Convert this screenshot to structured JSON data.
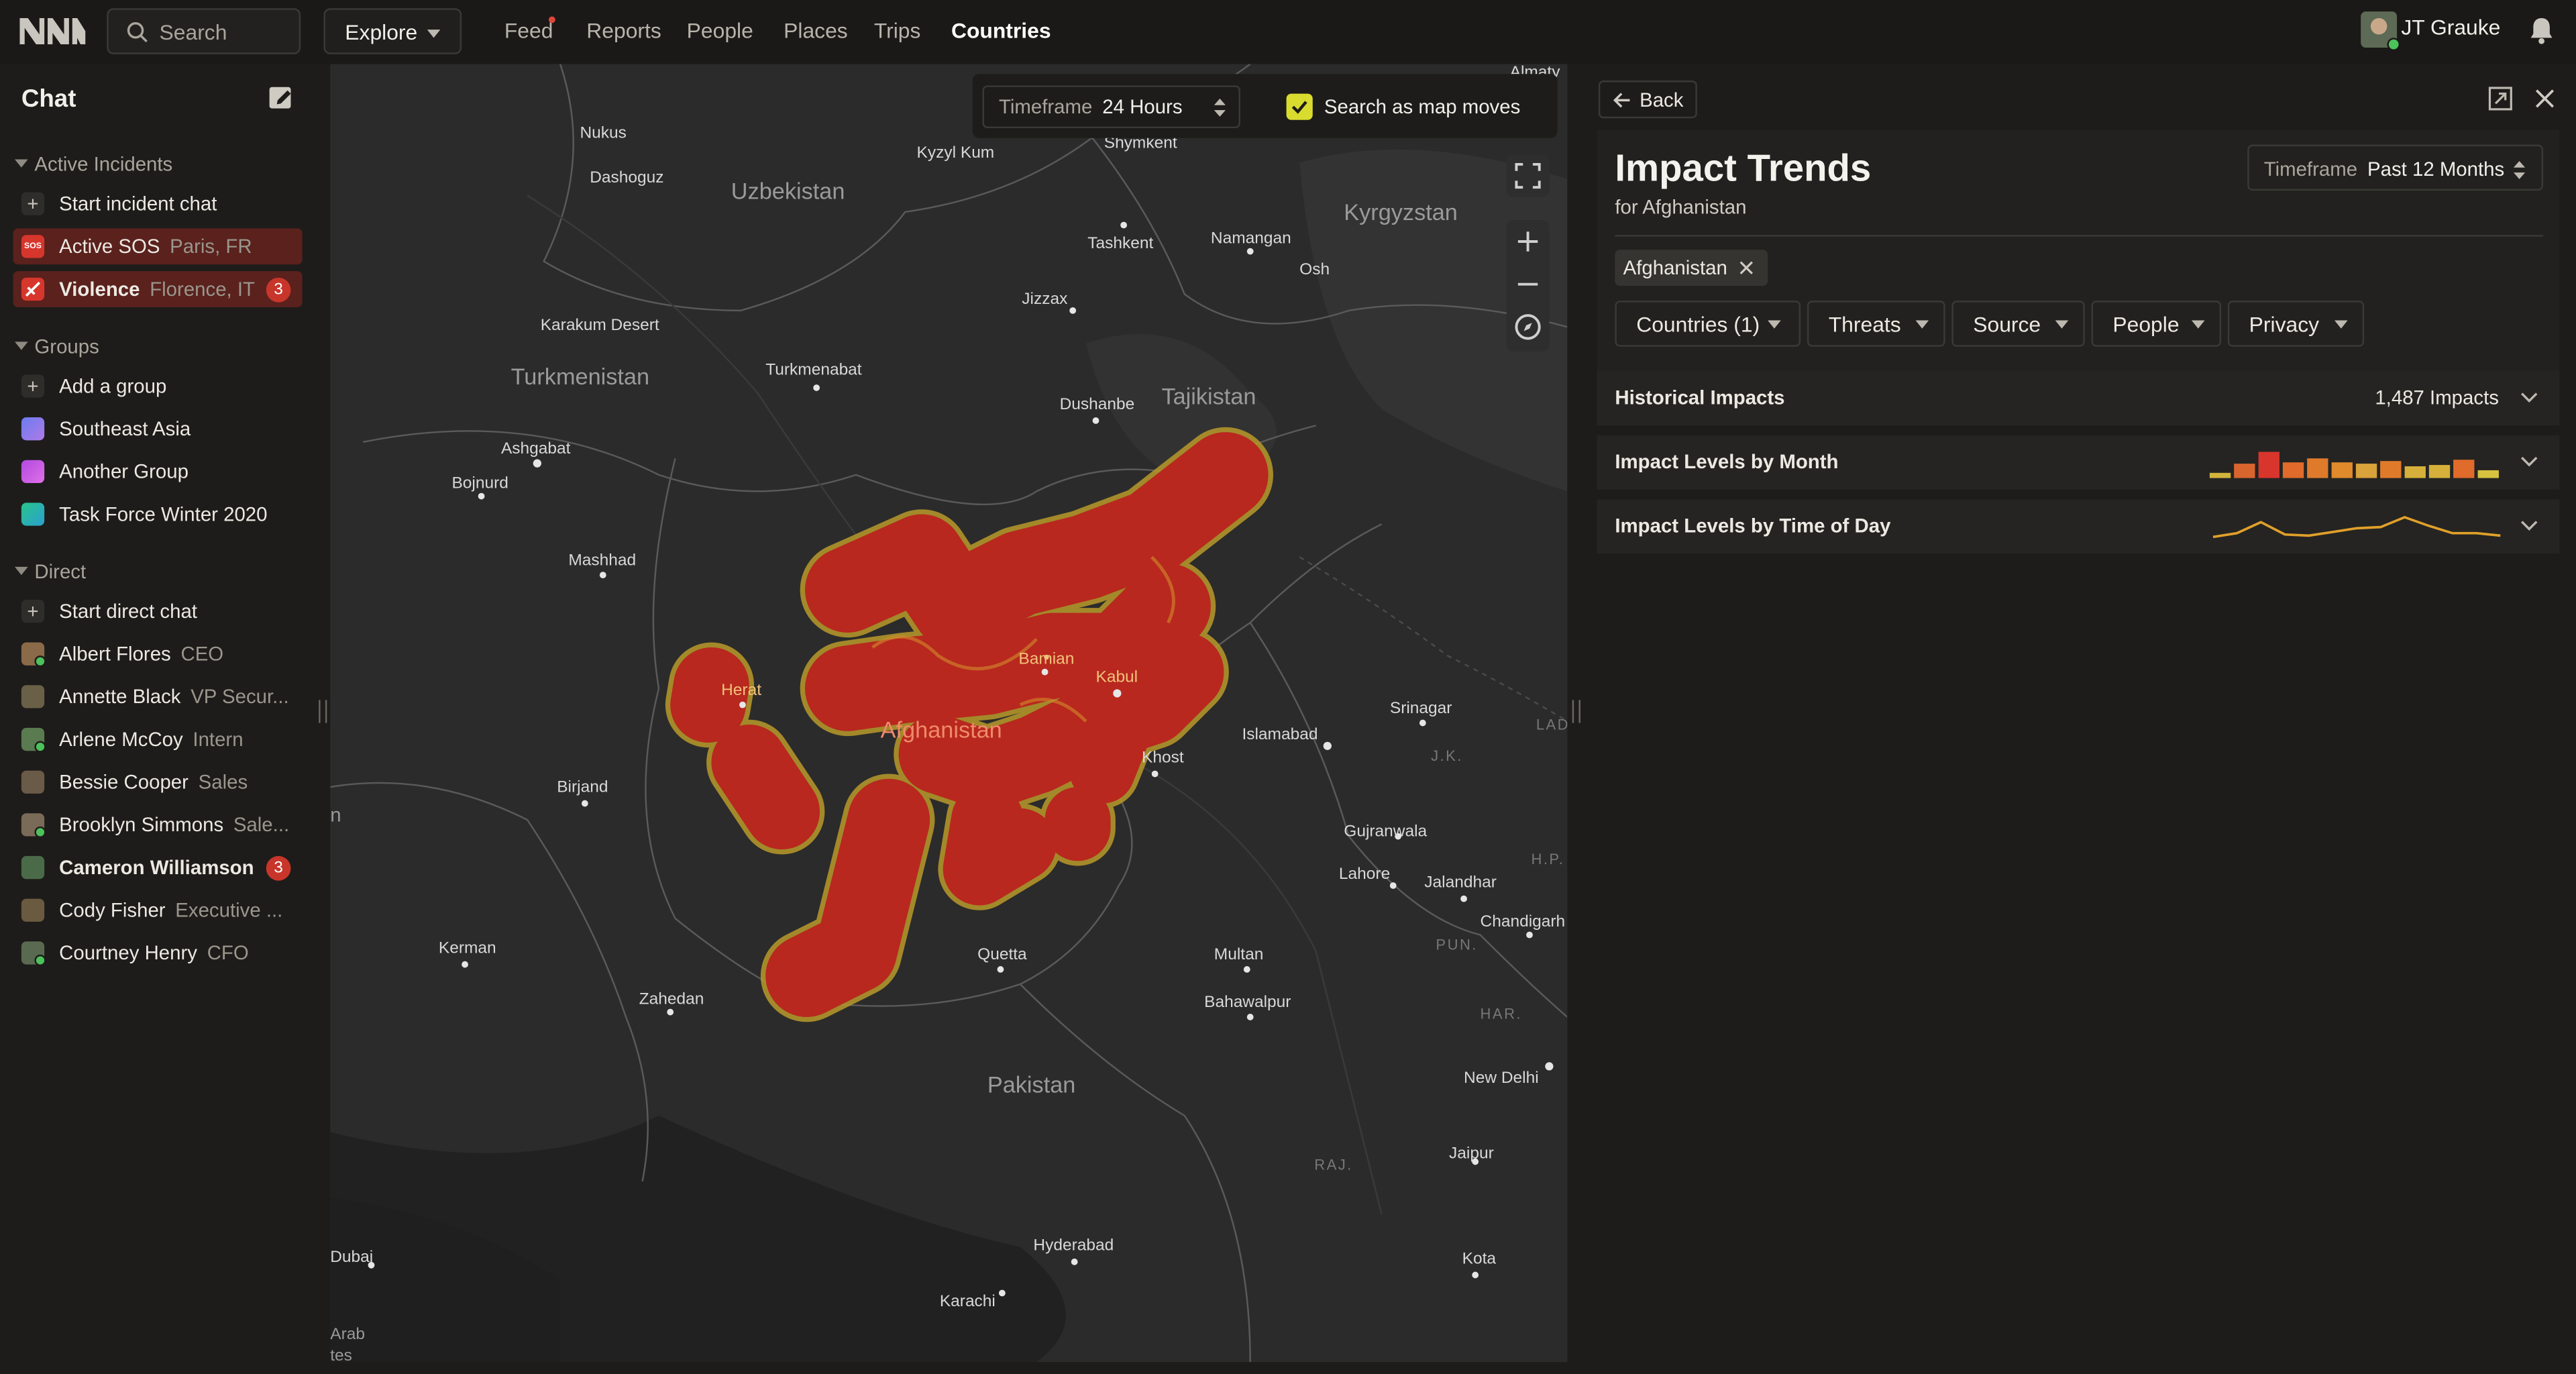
{
  "topbar": {
    "search_placeholder": "Search",
    "explore_label": "Explore",
    "nav": [
      "Feed",
      "Reports",
      "People",
      "Places",
      "Trips",
      "Countries"
    ],
    "active_nav": "Countries",
    "user_name": "JT Grauke"
  },
  "sidebar": {
    "title": "Chat",
    "active_incidents": {
      "heading": "Active Incidents",
      "start_label": "Start incident chat",
      "items": [
        {
          "label": "Active SOS",
          "sub": "Paris, FR",
          "badge": ""
        },
        {
          "label": "Violence",
          "sub": "Florence, IT",
          "badge": "3"
        }
      ]
    },
    "groups": {
      "heading": "Groups",
      "add_label": "Add a group",
      "items": [
        "Southeast Asia",
        "Another Group",
        "Task Force Winter 2020"
      ]
    },
    "direct": {
      "heading": "Direct",
      "start_label": "Start direct chat",
      "items": [
        {
          "name": "Albert Flores",
          "role": "CEO",
          "badge": ""
        },
        {
          "name": "Annette Black",
          "role": "VP Secur...",
          "badge": ""
        },
        {
          "name": "Arlene McCoy",
          "role": "Intern",
          "badge": ""
        },
        {
          "name": "Bessie Cooper",
          "role": "Sales",
          "badge": ""
        },
        {
          "name": "Brooklyn Simmons",
          "role": "Sale...",
          "badge": ""
        },
        {
          "name": "Cameron Williamson",
          "role": "",
          "badge": "3"
        },
        {
          "name": "Cody Fisher",
          "role": "Executive ...",
          "badge": ""
        },
        {
          "name": "Courtney Henry",
          "role": "CFO",
          "badge": ""
        }
      ]
    }
  },
  "map": {
    "timeframe_label": "Timeframe",
    "timeframe_value": "24 Hours",
    "search_as_moves": "Search as map moves",
    "search_as_moves_checked": true,
    "labels": {
      "countries": [
        "Uzbekistan",
        "Kyrgyzstan",
        "Turkmenistan",
        "Tajikistan",
        "Afghanistan",
        "Pakistan"
      ],
      "cities": [
        "Almaty",
        "Nukus",
        "Dashoguz",
        "Kyzyl Kum",
        "Shymkent",
        "Tashkent",
        "Namangan",
        "Osh",
        "Jizzax",
        "Karakum Desert",
        "Turkmenabat",
        "Dushanbe",
        "Ashgabat",
        "Bojnurd",
        "Mashhad",
        "Herat",
        "Bamian",
        "Kabul",
        "Islamabad",
        "Srinagar",
        "Khost",
        "Birjand",
        "Gujranwala",
        "Lahore",
        "Jalandhar",
        "Chandigarh",
        "Kerman",
        "Zahedan",
        "Quetta",
        "Multan",
        "Bahawalpur",
        "New Delhi",
        "Jaipur",
        "Hyderabad",
        "Karachi",
        "Kota",
        "Dubai",
        "Arab",
        "tes",
        "n",
        "LAD",
        "J.K.",
        "H.P.",
        "PUN.",
        "HAR.",
        "RAJ."
      ]
    }
  },
  "panel": {
    "back_label": "Back",
    "title": "Impact Trends",
    "subtitle": "for Afghanistan",
    "timeframe_label": "Timeframe",
    "timeframe_value": "Past 12 Months",
    "tag": "Afghanistan",
    "filters": [
      "Countries (1)",
      "Threats",
      "Source",
      "People",
      "Privacy"
    ],
    "sections": [
      {
        "title": "Historical Impacts",
        "value": "1,487 Impacts"
      },
      {
        "title": "Impact Levels by Month",
        "value": ""
      },
      {
        "title": "Impact Levels by Time of Day",
        "value": ""
      }
    ],
    "monthly_levels": [
      0.2,
      0.55,
      1.0,
      0.6,
      0.75,
      0.6,
      0.55,
      0.65,
      0.45,
      0.5,
      0.7,
      0.3
    ],
    "monthly_colors": [
      "#d2b43c",
      "#d9652e",
      "#d8352c",
      "#e06b2a",
      "#e07a2b",
      "#e08a2b",
      "#d9a23a",
      "#e07a2b",
      "#d6b03a",
      "#d6b03a",
      "#e06b2a",
      "#d6c23f"
    ],
    "time_of_day": [
      0.15,
      0.3,
      0.75,
      0.25,
      0.2,
      0.35,
      0.5,
      0.55,
      0.95,
      0.6,
      0.3,
      0.3,
      0.2
    ],
    "accent_color": "#e0a02a"
  }
}
